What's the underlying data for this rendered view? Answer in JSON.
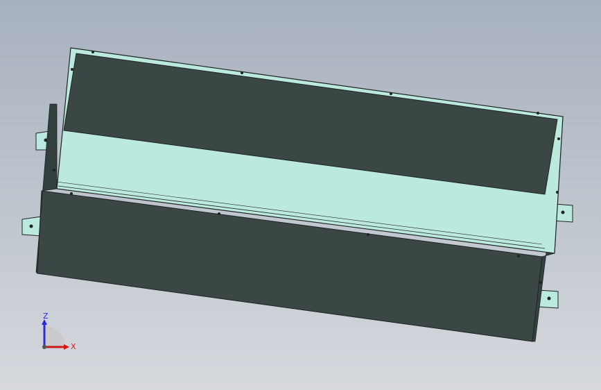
{
  "viewport": {
    "background_top": "#a7b1be",
    "background_bottom": "#d6d9de"
  },
  "model": {
    "name": "",
    "panel_color": "#3b4745",
    "frame_color": "#bce9dd",
    "edge_color": "#1d2322"
  },
  "triad": {
    "z_label": "Z",
    "x_label": "X",
    "z_color": "#2a2ae0",
    "x_color": "#d01818",
    "icon": "axis-triad-icon"
  }
}
